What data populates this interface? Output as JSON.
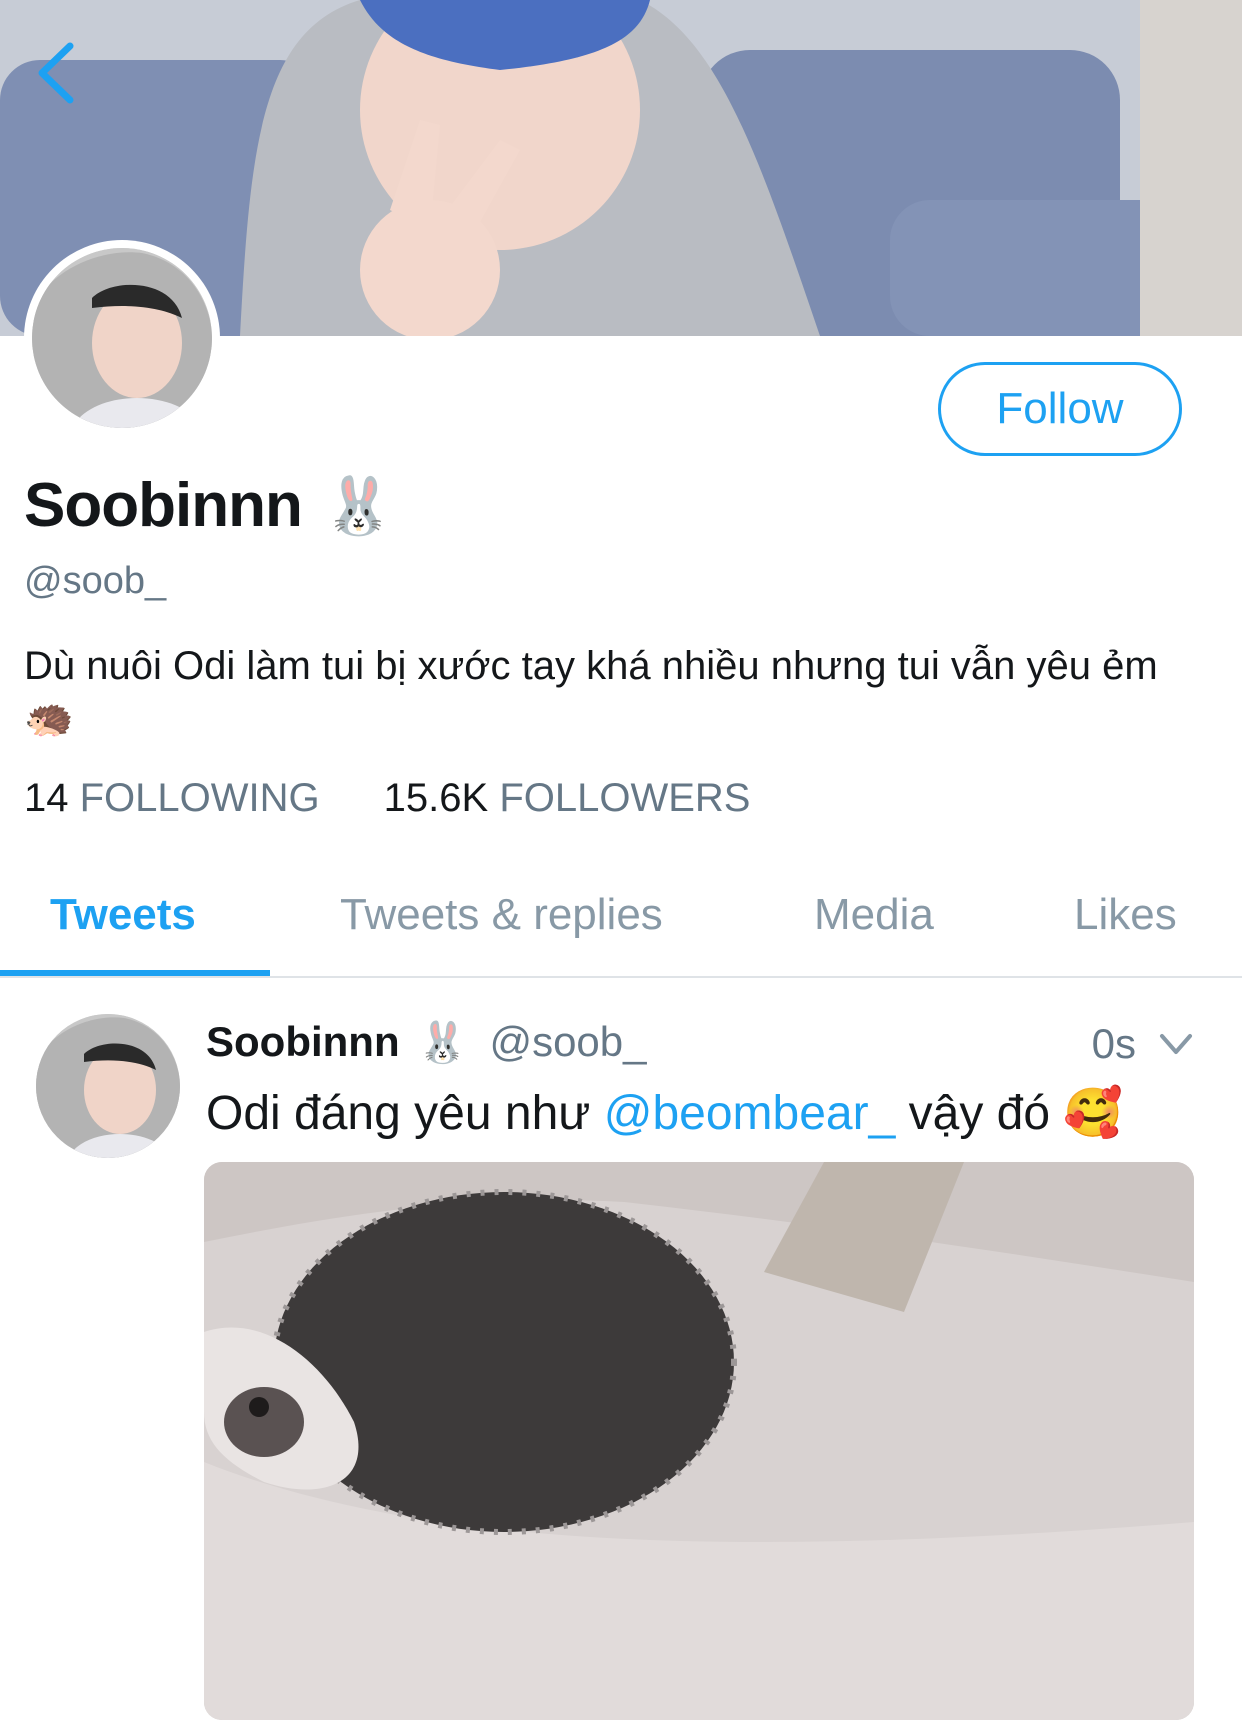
{
  "profile": {
    "display_name": "Soobinnn",
    "name_emoji": "🐰",
    "handle": "@soob_",
    "bio": "Dù nuôi Odi làm tui bị xước tay khá nhiều nhưng tui vẫn yêu ẻm 🦔",
    "follow_label": "Follow",
    "following_count": "14",
    "following_label": "FOLLOWING",
    "followers_count": "15.6K",
    "followers_label": "FOLLOWERS"
  },
  "tabs": [
    {
      "label": "Tweets",
      "active": true
    },
    {
      "label": "Tweets & replies",
      "active": false
    },
    {
      "label": "Media",
      "active": false
    },
    {
      "label": "Likes",
      "active": false
    }
  ],
  "tweet": {
    "name": "Soobinnn",
    "name_emoji": "🐰",
    "handle": "@soob_",
    "time": "0s",
    "text_before": "Odi đáng yêu như ",
    "mention": "@beombear_",
    "text_after": " vậy đó 🥰"
  },
  "icons": {
    "back": "chevron-left-icon",
    "caret": "chevron-down-icon"
  },
  "colors": {
    "accent": "#1da1f2",
    "secondary_text": "#657786"
  }
}
